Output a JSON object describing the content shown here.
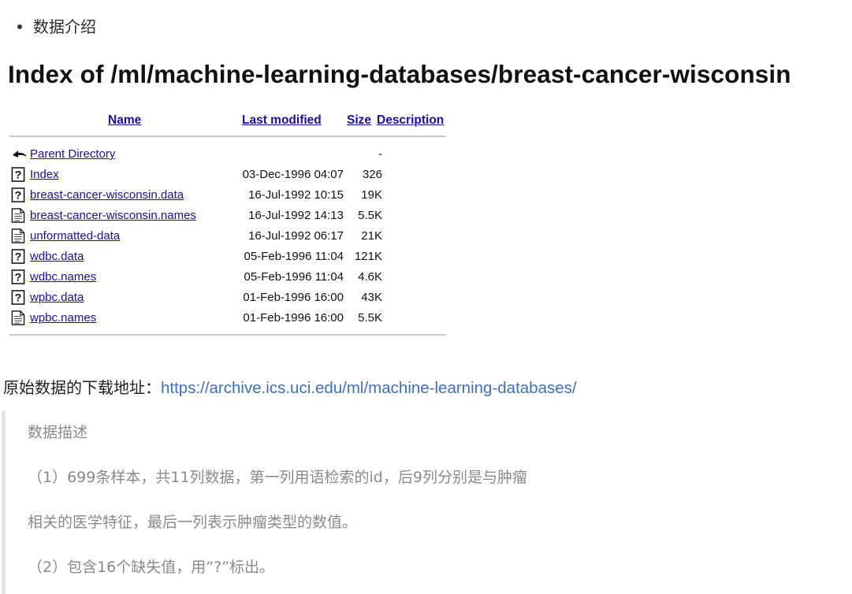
{
  "section_bullet": "数据介绍",
  "listing": {
    "title": "Index of /ml/machine-learning-databases/breast-cancer-wisconsin",
    "headers": {
      "name": "Name",
      "modified": "Last modified",
      "size": "Size",
      "description": "Description"
    },
    "rows": [
      {
        "icon": "back-arrow-icon",
        "name": "Parent Directory",
        "modified": "",
        "size": "-"
      },
      {
        "icon": "unknown-file-icon",
        "name": "Index",
        "modified": "03-Dec-1996 04:07",
        "size": "326"
      },
      {
        "icon": "unknown-file-icon",
        "name": "breast-cancer-wisconsin.data",
        "modified": "16-Jul-1992 10:15",
        "size": "19K"
      },
      {
        "icon": "text-file-icon",
        "name": "breast-cancer-wisconsin.names",
        "modified": "16-Jul-1992 14:13",
        "size": "5.5K"
      },
      {
        "icon": "text-file-icon",
        "name": "unformatted-data",
        "modified": "16-Jul-1992 06:17",
        "size": "21K"
      },
      {
        "icon": "unknown-file-icon",
        "name": "wdbc.data",
        "modified": "05-Feb-1996 11:04",
        "size": "121K"
      },
      {
        "icon": "unknown-file-icon",
        "name": "wdbc.names",
        "modified": "05-Feb-1996 11:04",
        "size": "4.6K"
      },
      {
        "icon": "unknown-file-icon",
        "name": "wpbc.data",
        "modified": "01-Feb-1996 16:00",
        "size": "43K"
      },
      {
        "icon": "text-file-icon",
        "name": "wpbc.names",
        "modified": "01-Feb-1996 16:00",
        "size": "5.5K"
      }
    ]
  },
  "download": {
    "label": "原始数据的下载地址：",
    "url": "https://archive.ics.uci.edu/ml/machine-learning-databases/"
  },
  "description": {
    "title": "数据描述",
    "line1": "（1）699条样本，共11列数据，第一列用语检索的id，后9列分别是与肿瘤",
    "line2": "相关的医学特征，最后一列表示肿瘤类型的数值。",
    "line3": "（2）包含16个缺失值，用”?”标出。"
  },
  "colors": {
    "link": "#1a0dab",
    "download_link": "#3f6fc0",
    "quote_text": "#8a8a8a",
    "quote_border": "#e3e3e3"
  }
}
